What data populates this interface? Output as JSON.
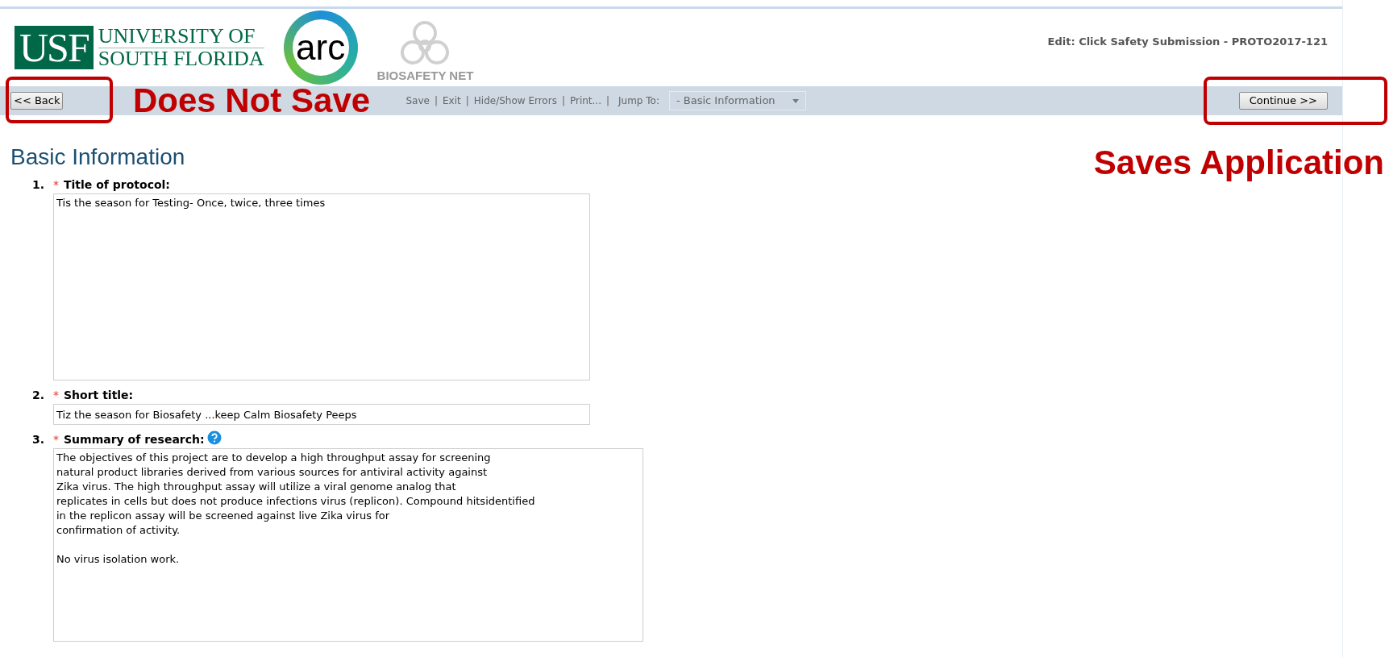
{
  "logos": {
    "usf_mark": "USF",
    "usf_line1": "UNIVERSITY OF",
    "usf_line2": "SOUTH FLORIDA",
    "arc": "arc",
    "biosafety": "BIOSAFETY NET"
  },
  "header_title": "Edit: Click Safety Submission - PROTO2017-121",
  "toolbar": {
    "back": "<< Back",
    "continue": "Continue >>",
    "items": [
      {
        "kind": "link",
        "text": "Save"
      },
      {
        "kind": "separator",
        "text": "|"
      },
      {
        "kind": "link",
        "text": "Exit"
      },
      {
        "kind": "separator",
        "text": "|"
      },
      {
        "kind": "link",
        "text": "Hide/Show Errors"
      },
      {
        "kind": "separator",
        "text": "|"
      },
      {
        "kind": "link",
        "text": "Print..."
      },
      {
        "kind": "separator",
        "text": "|"
      }
    ],
    "jump_label": "Jump To:",
    "jump_value": "- Basic Information"
  },
  "annotations": [
    {
      "kind": "left",
      "text": "Does Not Save"
    },
    {
      "kind": "right",
      "text": "Saves Application"
    }
  ],
  "section_title": "Basic Information",
  "questions": [
    {
      "number": "1.",
      "required": true,
      "label": "Title of protocol:",
      "kind": "textarea",
      "help": false,
      "value": "Tis the season for Testing- Once, twice, three times"
    },
    {
      "number": "2.",
      "required": true,
      "label": "Short title:",
      "kind": "input",
      "help": false,
      "value": "Tiz the season for Biosafety ...keep Calm Biosafety Peeps"
    },
    {
      "number": "3.",
      "required": true,
      "label": "Summary of research:",
      "kind": "textarea_wide",
      "help": true,
      "value": "The objectives of this project are to develop a high throughput assay for screening\nnatural product libraries derived from various sources for antiviral activity against\nZika virus. The high throughput assay will utilize a viral genome analog that\nreplicates in cells but does not produce infections virus (replicon). Compound hitsidentified\nin the replicon assay will be screened against live Zika virus for\nconfirmation of activity.\n\nNo virus isolation work."
    }
  ],
  "required_mark": "*"
}
